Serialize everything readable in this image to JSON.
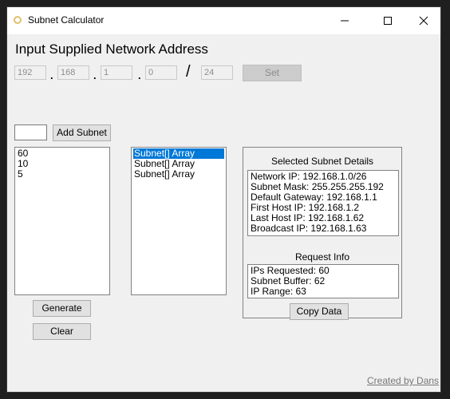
{
  "window": {
    "title": "Subnet Calculator",
    "controls": {
      "minimize": "minimize-icon",
      "maximize": "maximize-icon",
      "close": "close-icon"
    }
  },
  "network": {
    "heading": "Input Supplied Network Address",
    "octets": [
      "192",
      "168",
      "1",
      "0"
    ],
    "separators": [
      ".",
      ".",
      "."
    ],
    "slash": "/",
    "cidr": "24",
    "set_label": "Set"
  },
  "subnet_input": {
    "value": "",
    "add_label": "Add Subnet"
  },
  "requested_list": {
    "items": [
      "60",
      "10",
      "5"
    ]
  },
  "subnet_list": {
    "items": [
      "Subnet[] Array",
      "Subnet[] Array",
      "Subnet[] Array"
    ],
    "selected_index": 0
  },
  "details": {
    "title": "Selected Subnet Details",
    "lines": [
      "Network IP: 192.168.1.0/26",
      "Subnet Mask: 255.255.255.192",
      "Default Gateway: 192.168.1.1",
      "First Host IP: 192.168.1.2",
      "Last Host IP: 192.168.1.62",
      "Broadcast IP: 192.168.1.63"
    ],
    "request_title": "Request Info",
    "request_lines": [
      "IPs Requested: 60",
      "Subnet Buffer: 62",
      "IP Range: 63"
    ],
    "copy_label": "Copy Data"
  },
  "actions": {
    "generate_label": "Generate",
    "clear_label": "Clear"
  },
  "footer": {
    "credit": "Created by Dans"
  },
  "colors": {
    "selection": "#0078d7",
    "window_bg": "#f0f0f0",
    "button_bg": "#e1e1e1"
  }
}
